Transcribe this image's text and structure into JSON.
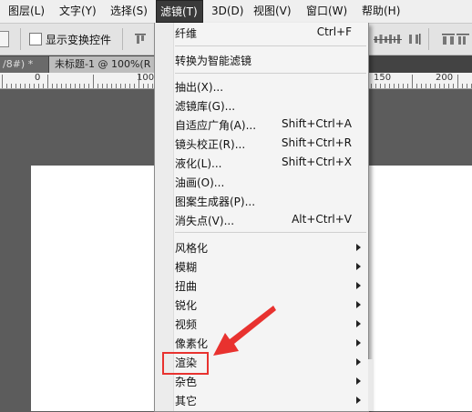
{
  "menubar": {
    "items": [
      {
        "label": "图层(L)"
      },
      {
        "label": "文字(Y)"
      },
      {
        "label": "选择(S)"
      },
      {
        "label": "滤镜(T)"
      },
      {
        "label": "3D(D)"
      },
      {
        "label": "视图(V)"
      },
      {
        "label": "窗口(W)"
      },
      {
        "label": "帮助(H)"
      }
    ]
  },
  "options": {
    "show_transform_label": "显示变换控件"
  },
  "tabs": [
    {
      "label": "/8#) *"
    },
    {
      "label": "未标题-1 @ 100%(R"
    }
  ],
  "ruler": {
    "numbers": [
      "0",
      "100",
      "150",
      "200"
    ]
  },
  "filter_menu": {
    "items": [
      {
        "label": "纤维",
        "shortcut": "Ctrl+F"
      },
      {
        "label": "转换为智能滤镜"
      },
      {
        "label": "抽出(X)..."
      },
      {
        "label": "滤镜库(G)..."
      },
      {
        "label": "自适应广角(A)...",
        "shortcut": "Shift+Ctrl+A"
      },
      {
        "label": "镜头校正(R)...",
        "shortcut": "Shift+Ctrl+R"
      },
      {
        "label": "液化(L)...",
        "shortcut": "Shift+Ctrl+X"
      },
      {
        "label": "油画(O)..."
      },
      {
        "label": "图案生成器(P)..."
      },
      {
        "label": "消失点(V)...",
        "shortcut": "Alt+Ctrl+V"
      },
      {
        "label": "风格化"
      },
      {
        "label": "模糊"
      },
      {
        "label": "扭曲"
      },
      {
        "label": "锐化"
      },
      {
        "label": "视频"
      },
      {
        "label": "像素化"
      },
      {
        "label": "渲染"
      },
      {
        "label": "杂色"
      },
      {
        "label": "其它"
      }
    ]
  },
  "colors": {
    "menu_active_bg": "#3a3a3a",
    "highlight": "#e8322f",
    "canvas_bg": "#5c5c5c"
  }
}
